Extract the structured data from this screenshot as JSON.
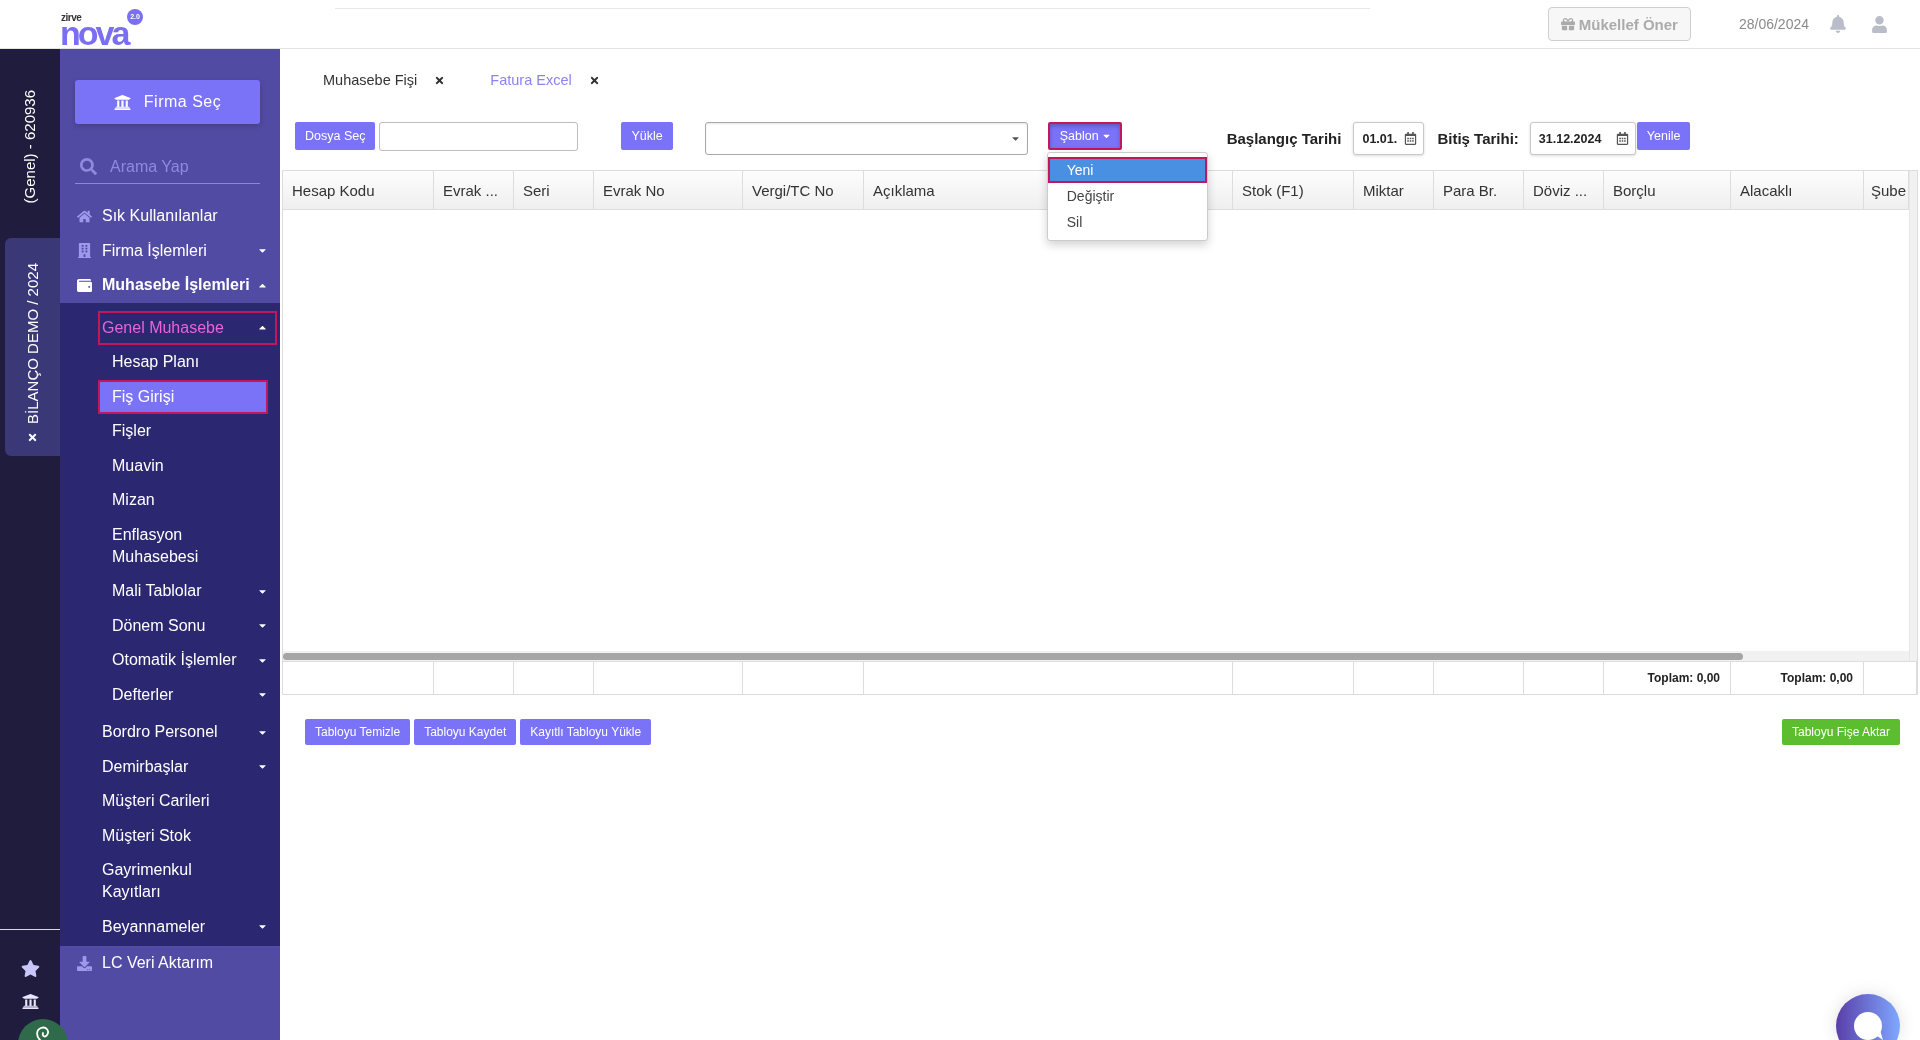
{
  "header": {
    "logo": {
      "tagline": "zirve",
      "name": "nova",
      "version": "2.0"
    },
    "recommend_button": "Mükellef Öner",
    "date": "28/06/2024"
  },
  "company_strip": {
    "company": "(Genel) - 620936",
    "open_tabs": [
      {
        "label": "BİLANÇO DEMO / 2024"
      }
    ]
  },
  "sidebar": {
    "company_button": "Firma Seç",
    "search": {
      "placeholder": "Arama Yap"
    },
    "items": [
      {
        "label": "Sık Kullanılanlar",
        "kind": "link",
        "selected": false,
        "highlighted": false
      },
      {
        "label": "Firma İşlemleri",
        "kind": "group",
        "expanded": false,
        "selected": false,
        "highlighted": false
      },
      {
        "label": "Muhasebe İşlemleri",
        "kind": "group",
        "expanded": true,
        "selected": false,
        "highlighted": false,
        "children": [
          {
            "label": "Genel Muhasebe",
            "kind": "group",
            "expanded": true,
            "selected": false,
            "highlighted": true,
            "children": [
              {
                "label": "Hesap Planı",
                "kind": "link",
                "selected": false,
                "highlighted": false
              },
              {
                "label": "Fiş Girişi",
                "kind": "link",
                "selected": true,
                "highlighted": true
              },
              {
                "label": "Fişler",
                "kind": "link",
                "selected": false,
                "highlighted": false
              },
              {
                "label": "Muavin",
                "kind": "link",
                "selected": false,
                "highlighted": false
              },
              {
                "label": "Mizan",
                "kind": "link",
                "selected": false,
                "highlighted": false
              },
              {
                "label": "Enflasyon Muhasebesi",
                "kind": "link",
                "selected": false,
                "highlighted": false
              },
              {
                "label": "Mali Tablolar",
                "kind": "group",
                "expanded": false,
                "selected": false,
                "highlighted": false
              },
              {
                "label": "Dönem Sonu",
                "kind": "group",
                "expanded": false,
                "selected": false,
                "highlighted": false
              },
              {
                "label": "Otomatik İşlemler",
                "kind": "group",
                "expanded": false,
                "selected": false,
                "highlighted": false
              },
              {
                "label": "Defterler",
                "kind": "group",
                "expanded": false,
                "selected": false,
                "highlighted": false
              }
            ]
          },
          {
            "label": "Bordro Personel",
            "kind": "group",
            "expanded": false,
            "selected": false,
            "highlighted": false
          },
          {
            "label": "Demirbaşlar",
            "kind": "group",
            "expanded": false,
            "selected": false,
            "highlighted": false
          },
          {
            "label": "Müşteri Carileri",
            "kind": "link",
            "selected": false,
            "highlighted": false
          },
          {
            "label": "Müşteri Stok",
            "kind": "link",
            "selected": false,
            "highlighted": false
          },
          {
            "label": "Gayrimenkul Kayıtları",
            "kind": "link",
            "selected": false,
            "highlighted": false
          },
          {
            "label": "Beyannameler",
            "kind": "group",
            "expanded": false,
            "selected": false,
            "highlighted": false
          }
        ]
      },
      {
        "label": "LC Veri Aktarım",
        "kind": "link",
        "selected": false,
        "highlighted": false
      }
    ]
  },
  "tabs": [
    {
      "label": "Muhasebe Fişi",
      "selected": false
    },
    {
      "label": "Fatura Excel",
      "selected": true
    }
  ],
  "toolbar": {
    "file_button": "Dosya Seç",
    "upload_button": "Yükle",
    "template_button": {
      "label": "Şablon",
      "highlighted": true,
      "expanded": true
    },
    "template_menu": [
      {
        "label": "Yeni",
        "selected": true,
        "highlighted": true
      },
      {
        "label": "Değiştir",
        "selected": false,
        "highlighted": false
      },
      {
        "label": "Sil",
        "selected": false,
        "highlighted": false
      }
    ],
    "start_date": {
      "label": "Başlangıç Tarihi",
      "value": "01.01."
    },
    "end_date": {
      "label": "Bitiş Tarihi:",
      "value": "31.12.2024"
    },
    "refresh_button": "Yenile"
  },
  "table": {
    "columns": [
      {
        "label": "Hesap Kodu"
      },
      {
        "label": "Evrak ..."
      },
      {
        "label": "Seri"
      },
      {
        "label": "Evrak No"
      },
      {
        "label": "Vergi/TC No"
      },
      {
        "label": "Açıklama"
      },
      {
        "label": "Stok (F1)"
      },
      {
        "label": "Miktar"
      },
      {
        "label": "Para Br."
      },
      {
        "label": "Döviz ..."
      },
      {
        "label": "Borçlu",
        "total": "Toplam: 0,00"
      },
      {
        "label": "Alacaklı",
        "total": "Toplam: 0,00"
      },
      {
        "label": "Şube"
      }
    ]
  },
  "actions": [
    {
      "label": "Tabloyu Temizle",
      "kind": "primary"
    },
    {
      "label": "Tabloyu Kaydet",
      "kind": "primary"
    },
    {
      "label": "Kayıtlı Tabloyu Yükle",
      "kind": "primary"
    },
    {
      "label": "Tabloyu Fişe Aktar",
      "kind": "success"
    }
  ]
}
